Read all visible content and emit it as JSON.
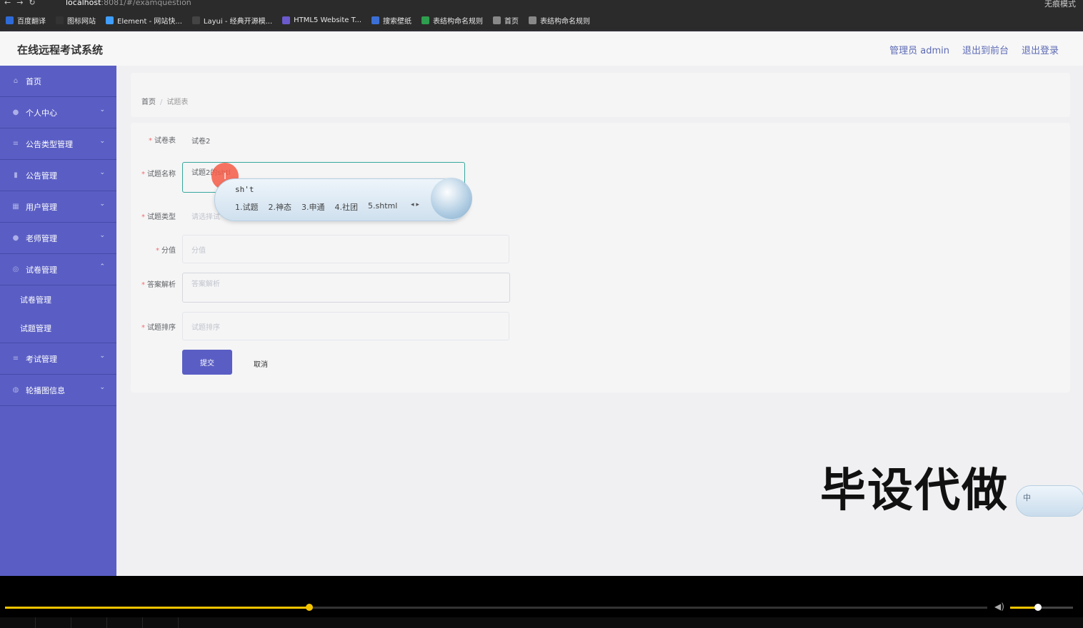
{
  "browser": {
    "url_host": "localhost",
    "url_path": ":8081/#/examquestion",
    "incognito_label": "无痕模式",
    "bookmarks": [
      {
        "label": "百度翻译",
        "color": "#2f6bd8"
      },
      {
        "label": "图标网站",
        "color": "#333333"
      },
      {
        "label": "Element - 网站快...",
        "color": "#409eff"
      },
      {
        "label": "Layui - 经典开源模...",
        "color": "#444444"
      },
      {
        "label": "HTML5 Website T...",
        "color": "#6a5acd"
      },
      {
        "label": "搜索壁纸",
        "color": "#3b6fd6"
      },
      {
        "label": "表结构命名规则",
        "color": "#2e9e4f"
      },
      {
        "label": "首页",
        "color": "#888888"
      },
      {
        "label": "表结构命名规则",
        "color": "#888888"
      }
    ]
  },
  "header": {
    "title": "在线远程考试系统",
    "user": "管理员 admin",
    "to_front": "退出到前台",
    "logout": "退出登录"
  },
  "sidebar": {
    "home": "首页",
    "personal": "个人中心",
    "notice_type": "公告类型管理",
    "notice": "公告管理",
    "user": "用户管理",
    "teacher": "老师管理",
    "paper": "试卷管理",
    "paper_sub_paper": "试卷管理",
    "paper_sub_question": "试题管理",
    "exam": "考试管理",
    "carousel": "轮播图信息"
  },
  "breadcrumb": {
    "home": "首页",
    "separator": "/",
    "current": "试题表"
  },
  "form": {
    "paper_label": "试卷表",
    "paper_value": "试卷2",
    "name_label": "试题名称",
    "name_value": "试题2的shtl",
    "type_label": "试题类型",
    "type_placeholder": "请选择试",
    "score_label": "分值",
    "score_placeholder": "分值",
    "analysis_label": "答案解析",
    "analysis_placeholder": "答案解析",
    "order_label": "试题排序",
    "order_placeholder": "试题排序",
    "submit": "提交",
    "cancel": "取消"
  },
  "ime": {
    "composition": "sh't",
    "candidates": [
      "1.试题",
      "2.神态",
      "3.申通",
      "4.社团",
      "5.shtml"
    ],
    "status": "中"
  },
  "watermark": "毕设代做",
  "player": {
    "progress": 0.31,
    "volume": 0.44
  }
}
